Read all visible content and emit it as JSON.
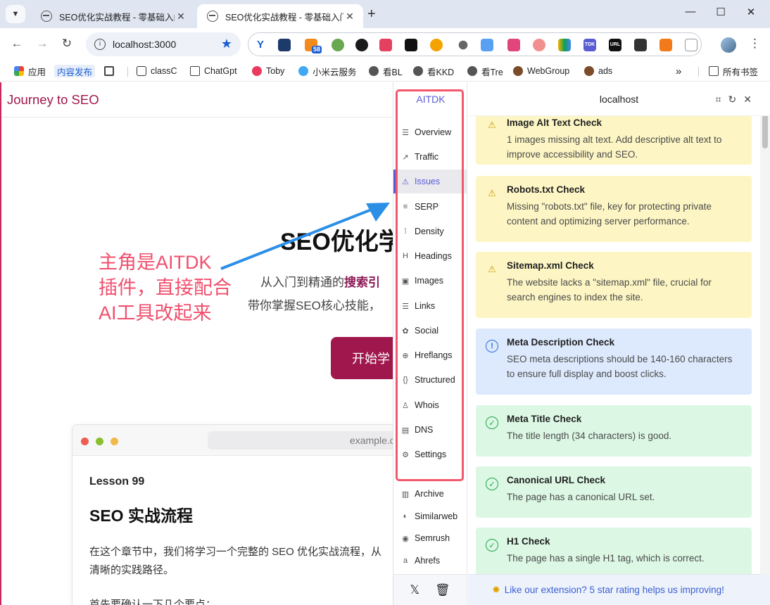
{
  "browser": {
    "tabs": [
      {
        "title": "SEO优化实战教程 - 零基础入门"
      },
      {
        "title": "SEO优化实战教程 - 零基础入门"
      }
    ],
    "address": "localhost:3000",
    "bookmarks": [
      "应用",
      "内容发布",
      "classC",
      "ChatGpt",
      "Toby",
      "小米云服务",
      "看BL",
      "看KKD",
      "看Tre",
      "WebGroup",
      "ads",
      "所有书签"
    ],
    "extension_icons": [
      "TDK",
      "URL"
    ]
  },
  "page": {
    "site_title": "Journey to SEO",
    "hero_title": "SEO优化学",
    "hero_sub1_prefix": "从入门到精通的",
    "hero_sub1_bold": "搜索引",
    "hero_sub2": "带你掌握SEO核心技能，",
    "cta": "开始学",
    "annotation": [
      "主角是AITDK",
      "插件，直接配合",
      "AI工具改起来"
    ],
    "mock_url": "example.c",
    "lesson_label": "Lesson 99",
    "lesson_title": "SEO 实战流程",
    "lesson_p1": "在这个章节中，我们将学习一个完整的 SEO 优化实战流程，从",
    "lesson_p1b": "清晰的实践路径。",
    "lesson_p2": "首先要确认一下几个要点："
  },
  "aitdk": {
    "brand": "AITDK",
    "nav": [
      {
        "label": "Overview",
        "icon": "overview-icon"
      },
      {
        "label": "Traffic",
        "icon": "traffic-icon"
      },
      {
        "label": "Issues",
        "icon": "warning-icon"
      },
      {
        "label": "SERP",
        "icon": "serp-icon"
      },
      {
        "label": "Density",
        "icon": "density-icon"
      },
      {
        "label": "Headings",
        "icon": "heading-icon"
      },
      {
        "label": "Images",
        "icon": "image-icon"
      },
      {
        "label": "Links",
        "icon": "links-icon"
      },
      {
        "label": "Social",
        "icon": "twitter-bird-icon"
      },
      {
        "label": "Hreflangs",
        "icon": "globe-icon"
      },
      {
        "label": "Structured",
        "icon": "braces-icon"
      },
      {
        "label": "Whois",
        "icon": "user-search-icon"
      },
      {
        "label": "DNS",
        "icon": "server-icon"
      },
      {
        "label": "Settings",
        "icon": "gear-icon"
      }
    ],
    "nav_extra": [
      {
        "label": "Archive",
        "icon": "archive-icon"
      },
      {
        "label": "Similarweb",
        "icon": "similarweb-icon"
      },
      {
        "label": "Semrush",
        "icon": "semrush-icon"
      },
      {
        "label": "Ahrefs",
        "icon": "ahrefs-icon"
      }
    ],
    "active": "Issues",
    "panel_title": "localhost",
    "issues": [
      {
        "type": "warning",
        "title": "Image Alt Text Check",
        "desc": "1 images missing alt text. Add descriptive alt text to improve accessibility and SEO."
      },
      {
        "type": "warning",
        "title": "Robots.txt Check",
        "desc": "Missing \"robots.txt\" file, key for protecting private content and optimizing server performance."
      },
      {
        "type": "warning",
        "title": "Sitemap.xml Check",
        "desc": "The website lacks a \"sitemap.xml\" file, crucial for search engines to index the site."
      },
      {
        "type": "info",
        "title": "Meta Description Check",
        "desc": "SEO meta descriptions should be 140-160 characters to ensure full display and boost clicks."
      },
      {
        "type": "ok",
        "title": "Meta Title Check",
        "desc": "The title length (34 characters) is good."
      },
      {
        "type": "ok",
        "title": "Canonical URL Check",
        "desc": "The page has a canonical URL set."
      },
      {
        "type": "ok",
        "title": "H1 Check",
        "desc": "The page has a single H1 tag, which is correct."
      }
    ],
    "footer_text": "Like our extension? 5 star rating helps us improving!",
    "colors": {
      "accent": "#5b5bd6",
      "highlight_frame": "#f2586b",
      "brand_red": "#a0174d"
    }
  }
}
